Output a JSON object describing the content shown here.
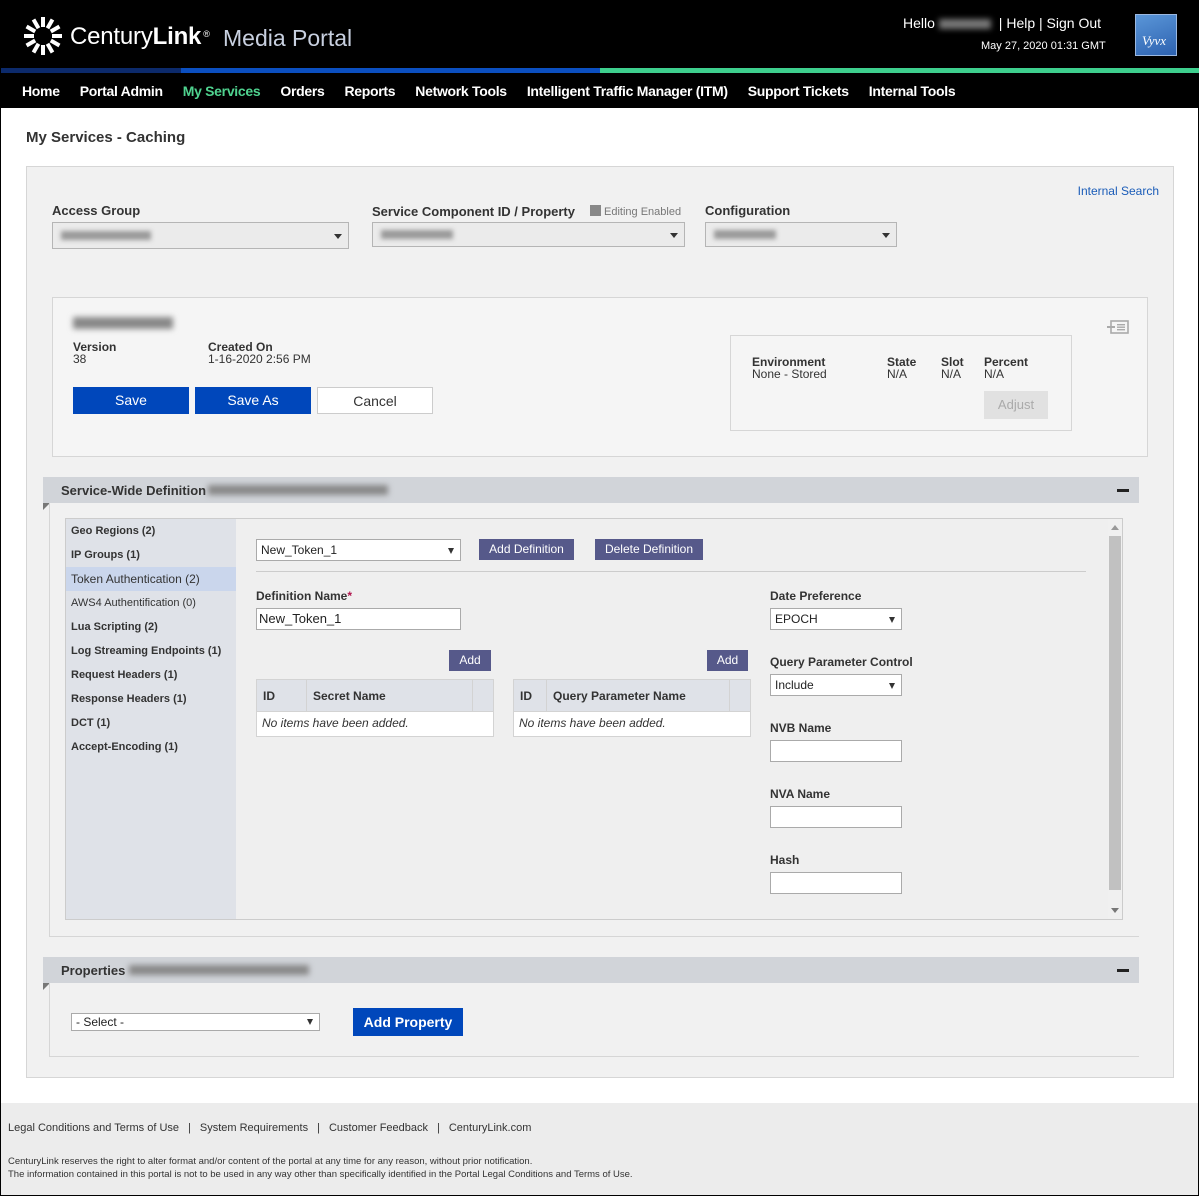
{
  "header": {
    "brand": "CenturyLink",
    "brand_bold": "Link",
    "brand_plain": "Century",
    "portal_name": "Media Portal",
    "hello": "Hello",
    "help": "Help",
    "sign_out": "Sign Out",
    "separator": "|",
    "datetime": "May 27, 2020 01:31 GMT",
    "partner_logo": "Vyvx",
    "colors": {
      "stripe_dark": "#0c2a6b",
      "stripe_blue": "#0b4fc0",
      "stripe_green": "#3ecf8e",
      "active_nav": "#4fd38f"
    }
  },
  "nav": {
    "items": [
      {
        "label": "Home"
      },
      {
        "label": "Portal Admin"
      },
      {
        "label": "My Services",
        "active": true
      },
      {
        "label": "Orders"
      },
      {
        "label": "Reports"
      },
      {
        "label": "Network Tools"
      },
      {
        "label": "Intelligent Traffic Manager (ITM)"
      },
      {
        "label": "Support Tickets"
      },
      {
        "label": "Internal Tools"
      }
    ]
  },
  "page": {
    "title": "My Services - Caching",
    "internal_search": "Internal Search",
    "access_group_label": "Access Group",
    "service_component_label": "Service Component ID / Property",
    "editing_enabled": "Editing Enabled",
    "configuration_label": "Configuration"
  },
  "config": {
    "version_label": "Version",
    "version": "38",
    "created_label": "Created On",
    "created": "1-16-2020 2:56 PM",
    "save": "Save",
    "save_as": "Save As",
    "cancel": "Cancel",
    "env": {
      "environment_label": "Environment",
      "environment": "None - Stored",
      "state_label": "State",
      "state": "N/A",
      "slot_label": "Slot",
      "slot": "N/A",
      "percent_label": "Percent",
      "percent": "N/A",
      "adjust": "Adjust"
    }
  },
  "service_wide": {
    "title": "Service-Wide Definition",
    "categories": [
      {
        "label": "Geo Regions (2)"
      },
      {
        "label": "IP Groups (1)"
      },
      {
        "label": "Token Authentication (2)",
        "selected": true
      },
      {
        "label": "AWS4 Authentification (0)"
      },
      {
        "label": "Lua Scripting (2)"
      },
      {
        "label": "Log Streaming Endpoints (1)"
      },
      {
        "label": "Request Headers (1)"
      },
      {
        "label": "Response Headers (1)"
      },
      {
        "label": "DCT (1)"
      },
      {
        "label": "Accept-Encoding (1)"
      }
    ],
    "definition_select": "New_Token_1",
    "add_definition": "Add Definition",
    "delete_definition": "Delete Definition",
    "definition_name_label": "Definition Name",
    "required_mark": "*",
    "definition_name_value": "New_Token_1",
    "add": "Add",
    "secrets_table": {
      "columns": [
        "ID",
        "Secret Name",
        ""
      ],
      "empty": "No items have been added."
    },
    "query_table": {
      "columns": [
        "ID",
        "Query Parameter Name",
        ""
      ],
      "empty": "No items have been added."
    },
    "date_pref_label": "Date Preference",
    "date_pref_value": "EPOCH",
    "qpc_label": "Query Parameter Control",
    "qpc_value": "Include",
    "nvb_label": "NVB Name",
    "nvb_value": "",
    "nva_label": "NVA Name",
    "nva_value": "",
    "hash_label": "Hash",
    "hash_value": ""
  },
  "properties": {
    "title": "Properties",
    "select_value": "- Select -",
    "add_property": "Add Property"
  },
  "footer": {
    "links": [
      {
        "label": "Legal Conditions and Terms of Use"
      },
      {
        "label": "System Requirements"
      },
      {
        "label": "Customer Feedback"
      },
      {
        "label": "CenturyLink.com"
      }
    ],
    "note1": "CenturyLink reserves the right to alter format and/or content of the portal at any time for any reason, without prior notification.",
    "note2": "The information contained in this portal is not to be used in any way other than specifically identified in the Portal Legal Conditions and Terms of Use."
  }
}
